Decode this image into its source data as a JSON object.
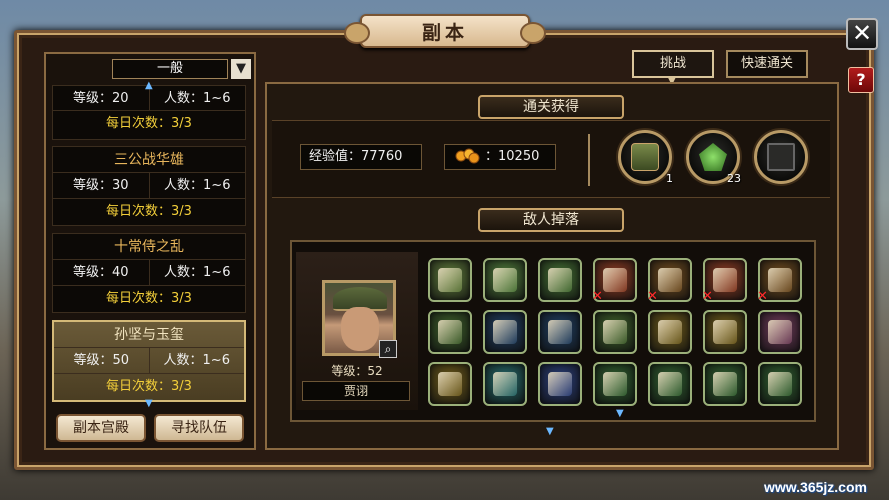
{
  "window": {
    "title": "副本",
    "close_icon": "close-icon",
    "help_label": "?"
  },
  "tabs": [
    {
      "label": "挑战",
      "active": true
    },
    {
      "label": "快速通关",
      "active": false
    }
  ],
  "left_panel": {
    "filter": {
      "selected": "一般",
      "arrow": "▼"
    },
    "entries": [
      {
        "title": "",
        "level": "等级：20",
        "people": "人数：1~6",
        "daily": "每日次数：3/3",
        "selected": false,
        "partial": true
      },
      {
        "title": "三公战华雄",
        "level": "等级：30",
        "people": "人数：1~6",
        "daily": "每日次数：3/3",
        "selected": false
      },
      {
        "title": "十常侍之乱",
        "level": "等级：40",
        "people": "人数：1~6",
        "daily": "每日次数：3/3",
        "selected": false
      },
      {
        "title": "孙坚与玉玺",
        "level": "等级：50",
        "people": "人数：1~6",
        "daily": "每日次数：3/3",
        "selected": true
      }
    ],
    "buttons": {
      "palace": "副本宫殿",
      "find_team": "寻找队伍"
    }
  },
  "clear_rewards": {
    "header": "通关获得",
    "exp": "经验值：77760",
    "gold": "：10250",
    "slots": [
      {
        "icon": "locked-chest-icon",
        "count": "1"
      },
      {
        "icon": "green-jade-icon",
        "count": "23"
      },
      {
        "icon": "iron-box-icon",
        "count": ""
      }
    ]
  },
  "enemy_drops": {
    "header": "敌人掉落",
    "boss": {
      "level": "等级：52",
      "name": "贾诩"
    },
    "items_row1": [
      {
        "icon": "silver-ingot-icon",
        "color": "#5e7a3a",
        "x": false
      },
      {
        "icon": "iron-ore-icon",
        "color": "#4f7b3a",
        "x": false
      },
      {
        "icon": "scroll-icon",
        "color": "#436e32",
        "x": false
      },
      {
        "icon": "scepter-icon",
        "color": "#8a3a22",
        "x": true
      },
      {
        "icon": "robe-icon",
        "color": "#6e4a1e",
        "x": true
      },
      {
        "icon": "scepter-icon",
        "color": "#8a3a22",
        "x": true
      },
      {
        "icon": "robe-icon",
        "color": "#6e4a1e",
        "x": true
      }
    ],
    "items_row2": [
      {
        "icon": "treasure-chest-icon",
        "color": "#3d5f2a",
        "x": false
      },
      {
        "icon": "gold-crown-icon",
        "color": "#1f3d60",
        "x": false
      },
      {
        "icon": "bamboo-scroll-icon",
        "color": "#1f3d60",
        "x": false
      },
      {
        "icon": "armor-icon",
        "color": "#3d5f2a",
        "x": false
      },
      {
        "icon": "orange-book-icon",
        "color": "#6d5a1a",
        "x": false
      },
      {
        "icon": "orange-book-icon",
        "color": "#6d5a1a",
        "x": false
      },
      {
        "icon": "pink-book-icon",
        "color": "#6d3a58",
        "x": false
      }
    ],
    "items_row3": [
      {
        "icon": "orange-book-icon",
        "color": "#6d5a1a",
        "x": false
      },
      {
        "icon": "teal-book-icon",
        "color": "#256a6a",
        "x": false
      },
      {
        "icon": "blue-book-icon",
        "color": "#2a3e7a",
        "x": false
      },
      {
        "icon": "paper-scroll-icon",
        "color": "#2f5f2f",
        "x": false
      },
      {
        "icon": "paper-scroll-icon",
        "color": "#2f5f2f",
        "x": false
      },
      {
        "icon": "white-gem-icon",
        "color": "#2f5f2f",
        "x": false
      },
      {
        "icon": "grey-gem-icon",
        "color": "#2f5f2f",
        "x": false
      }
    ]
  },
  "watermark": "www.365jz.com"
}
